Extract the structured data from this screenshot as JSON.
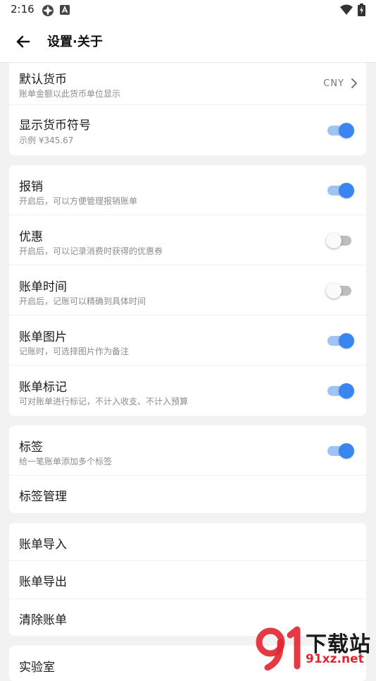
{
  "status_bar": {
    "time": "2:16"
  },
  "header": {
    "title": "设置·关于"
  },
  "currency": {
    "default_currency": {
      "title": "默认货币",
      "subtitle": "账单金额以此货币单位显示",
      "value": "CNY"
    },
    "show_symbol": {
      "title": "显示货币符号",
      "subtitle": "示例 ¥345.67",
      "enabled": true
    }
  },
  "features": [
    {
      "title": "报销",
      "subtitle": "开启后，可以方便管理报销账单",
      "enabled": true
    },
    {
      "title": "优惠",
      "subtitle": "开启后，可以记录消费时获得的优惠券",
      "enabled": false
    },
    {
      "title": "账单时间",
      "subtitle": "开启后，记账可以精确到具体时间",
      "enabled": false
    },
    {
      "title": "账单图片",
      "subtitle": "记账时，可选择图片作为备注",
      "enabled": true
    },
    {
      "title": "账单标记",
      "subtitle": "可对账单进行标记，不计入收支、不计入预算",
      "enabled": true
    }
  ],
  "tags": {
    "tags_toggle": {
      "title": "标签",
      "subtitle": "给一笔账单添加多个标签",
      "enabled": true
    },
    "manage": {
      "title": "标签管理"
    }
  },
  "bills": {
    "import": "账单导入",
    "export": "账单导出",
    "clear": "清除账单"
  },
  "lab": {
    "title": "实验室"
  },
  "watermark": {
    "title": "下载站",
    "url": "91xz.net"
  },
  "colors": {
    "accent": "#3a86f0",
    "accent_track": "#9ec3f5",
    "off_track": "#bdbdbd",
    "background": "#f2f2f2",
    "card": "#ffffff",
    "watermark_red": "#e2252f"
  }
}
